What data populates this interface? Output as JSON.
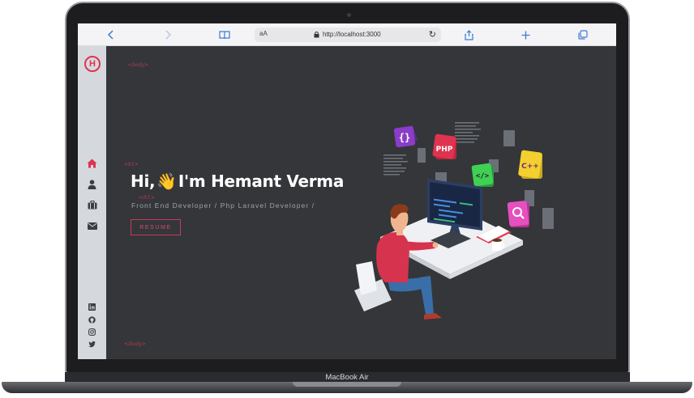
{
  "device": {
    "label": "MacBook Air"
  },
  "browser": {
    "text_size_label": "aA",
    "url": "http://localhost:3000"
  },
  "sidebar": {
    "logo_letter": "H",
    "nav_items": [
      {
        "name": "home",
        "icon": "home-icon",
        "active": true
      },
      {
        "name": "about",
        "icon": "user-icon",
        "active": false
      },
      {
        "name": "portfolio",
        "icon": "briefcase-icon",
        "active": false
      },
      {
        "name": "contact",
        "icon": "envelope-icon",
        "active": false
      }
    ],
    "social": [
      {
        "name": "linkedin",
        "icon": "linkedin-icon"
      },
      {
        "name": "github",
        "icon": "github-icon"
      },
      {
        "name": "instagram",
        "icon": "instagram-icon"
      },
      {
        "name": "twitter",
        "icon": "twitter-icon"
      }
    ]
  },
  "hero": {
    "greeting": "Hi,",
    "wave_emoji": "👋",
    "intro": "I'm Hemant Verma",
    "subtitle": "Front End Developer / Php Laravel Developer /",
    "resume_label": "RESUME",
    "tag_body_open": "<body>",
    "tag_body_close": "</body>",
    "tag_h1_open": "<h1>",
    "tag_h1_close": "</h1>"
  },
  "illustration": {
    "badges": [
      "{}",
      "PHP",
      "</>",
      "C++"
    ]
  },
  "colors": {
    "accent": "#e0334f",
    "background": "#34363a",
    "sidebar": "#d5d9de"
  }
}
